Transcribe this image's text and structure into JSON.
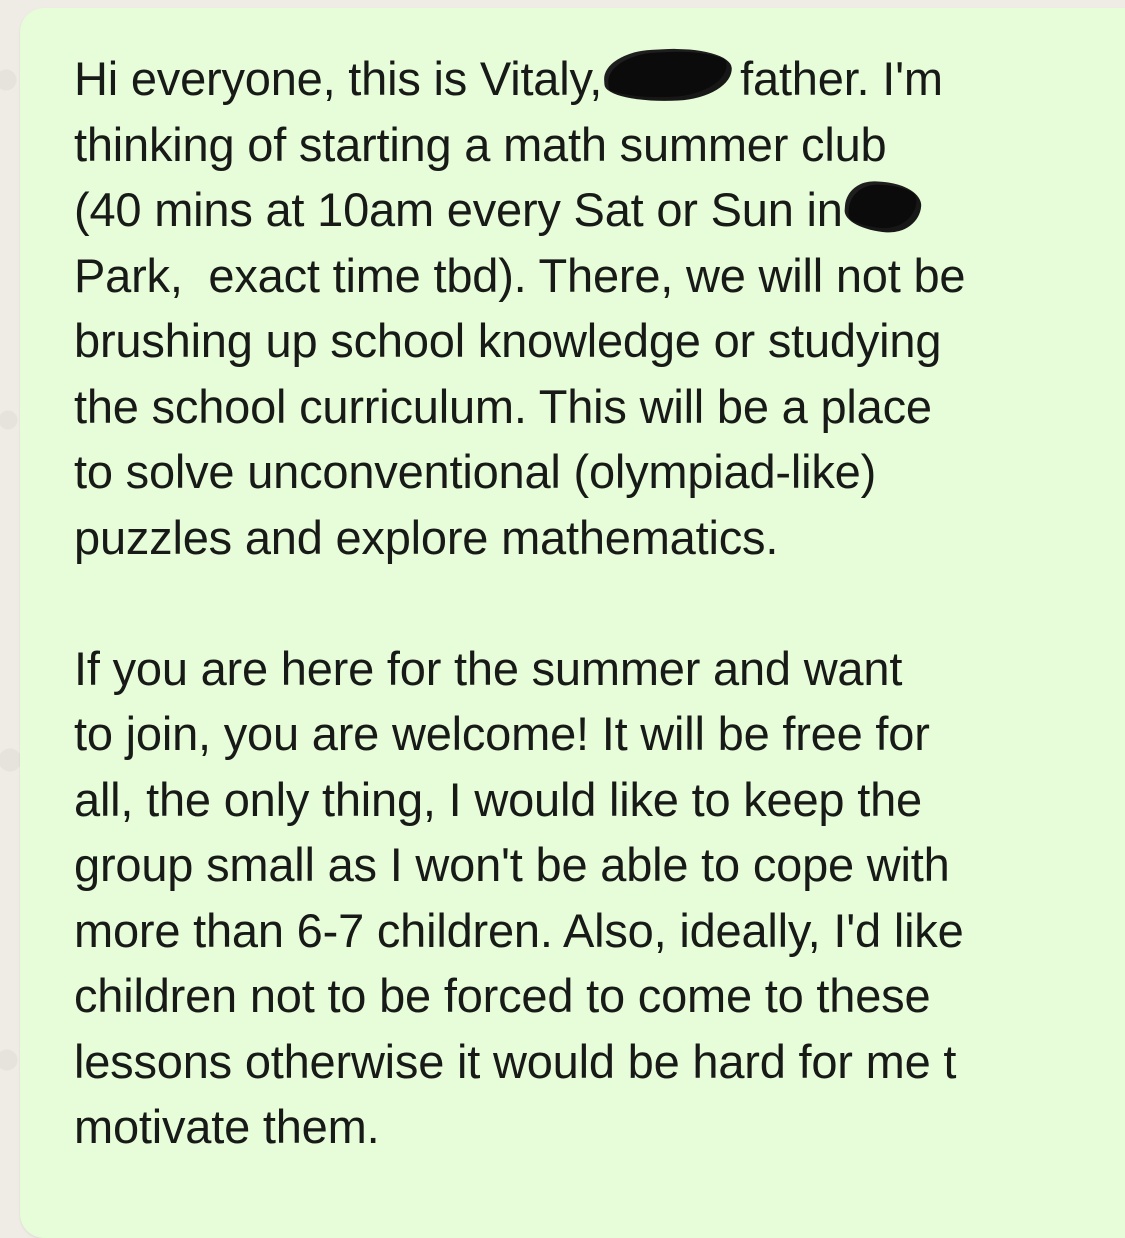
{
  "message": {
    "line1_before": "Hi everyone, this is Vitaly,",
    "line1_after": "father. I'm",
    "line2": "thinking of starting a math summer club",
    "line3_before": "(40 mins at 10am every Sat or Sun in",
    "line4": "Park,  exact time tbd). There, we will not be",
    "line5": "brushing up school knowledge or studying",
    "line6": "the school curriculum. This will be a place",
    "line7": "to solve unconventional (olympiad-like)",
    "line8": "puzzles and explore mathematics.",
    "line10": "If you are here for the summer and want",
    "line11": "to join, you are welcome! It will be free for",
    "line12": "all, the only thing, I would like to keep the",
    "line13": "group small as I won't be able to cope with",
    "line14": "more than 6-7 children. Also, ideally, I'd like",
    "line15": "children not to be forced to come to these",
    "line16": "lessons otherwise it would be hard for me t",
    "line17": "motivate them."
  },
  "colors": {
    "bubble": "#e7fcd9",
    "background": "#efebe5",
    "text": "#171a17",
    "redaction": "#0b0b0b"
  }
}
